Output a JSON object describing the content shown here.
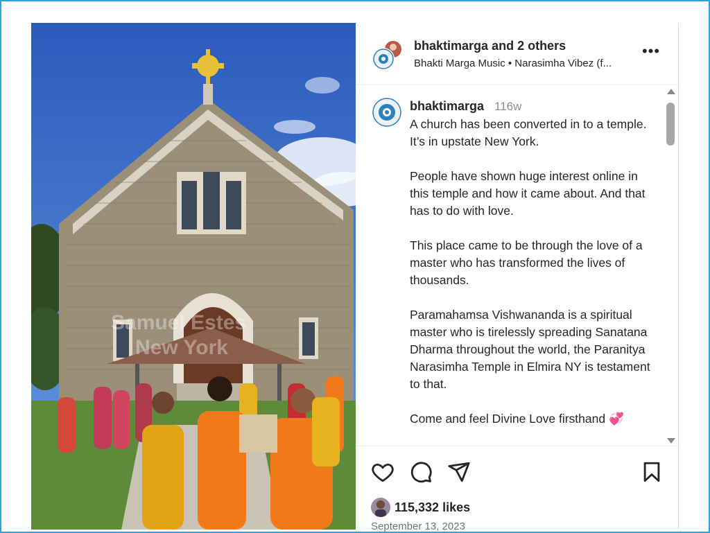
{
  "post": {
    "header": {
      "username": "bhaktimarga",
      "and_others": "and 2 others",
      "subtitle": "Bhakti Marga Music • Narasimha Vibez (f..."
    },
    "caption": {
      "username": "bhaktimarga",
      "age": "116w",
      "text": "A church has been converted in to a temple. It’s in upstate New York.\n\nPeople have shown huge interest online in this temple and how it came about. And that has to do with love.\n\nThis place came to be through the love of a master who has transformed the lives of thousands.\n\nParamahamsa Vishwananda is a spiritual master who is tirelessly spreading Sanatana Dharma throughout the world, the Paranitya Narasimha Temple in Elmira NY is testament to that.\n\nCome and feel Divine Love firsthand 💞"
    },
    "likes": "115,332 likes",
    "date": "September 13, 2023",
    "media_watermark": {
      "line1": "Samuel Estes",
      "line2": "New York"
    }
  },
  "icons": {
    "more": "more-options-icon",
    "like": "heart-icon",
    "comment": "comment-icon",
    "share": "share-icon",
    "save": "bookmark-icon"
  },
  "colors": {
    "frame_border": "#2ba3e8",
    "text": "#262626",
    "muted": "#8e8e8e",
    "sky": "#3f74c8",
    "robe": "#f07a1a"
  }
}
